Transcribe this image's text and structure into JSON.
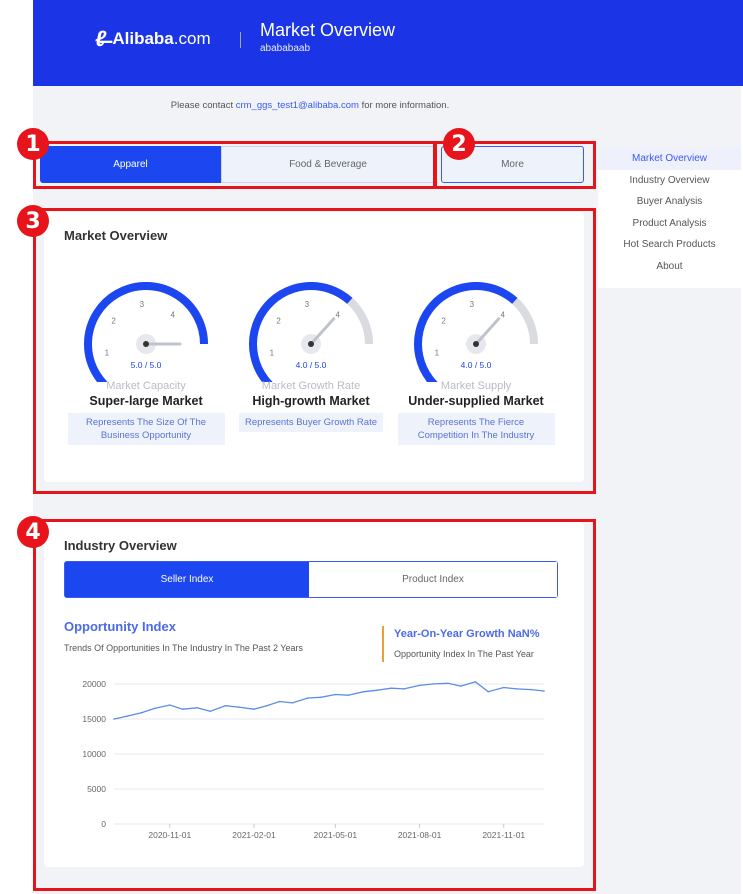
{
  "header": {
    "logo_text": "Alibaba",
    "logo_suffix": ".com",
    "title": "Market Overview",
    "subtitle": "abababaab"
  },
  "contact": {
    "prefix": "Please contact",
    "email": "crm_ggs_test1@alibaba.com",
    "suffix": "for more information."
  },
  "tabs": [
    {
      "label": "Apparel",
      "active": true
    },
    {
      "label": "Food & Beverage",
      "active": false
    },
    {
      "label": "More",
      "active": false
    }
  ],
  "sidenav": [
    {
      "label": "Market Overview",
      "active": true
    },
    {
      "label": "Industry Overview",
      "active": false
    },
    {
      "label": "Buyer Analysis",
      "active": false
    },
    {
      "label": "Product Analysis",
      "active": false
    },
    {
      "label": "Hot Search Products",
      "active": false
    },
    {
      "label": "About",
      "active": false
    }
  ],
  "market_overview": {
    "title": "Market Overview",
    "gauges": [
      {
        "label": "Market Capacity",
        "verdict": "Super-large Market",
        "desc": "Represents The Size Of The Business Opportunity",
        "value": 5.0,
        "max": 5.0,
        "readout": "5.0 / 5.0"
      },
      {
        "label": "Market Growth Rate",
        "verdict": "High-growth Market",
        "desc": "Represents Buyer Growth Rate",
        "value": 4.0,
        "max": 5.0,
        "readout": "4.0 / 5.0"
      },
      {
        "label": "Market Supply",
        "verdict": "Under-supplied Market",
        "desc": "Represents The Fierce Competition In The Industry",
        "value": 4.0,
        "max": 5.0,
        "readout": "4.0 / 5.0"
      }
    ],
    "tick_labels": [
      "1",
      "2",
      "3",
      "4"
    ]
  },
  "industry_overview": {
    "title": "Industry Overview",
    "segments": [
      {
        "label": "Seller Index",
        "active": true
      },
      {
        "label": "Product Index",
        "active": false
      }
    ],
    "opportunity_title": "Opportunity Index",
    "opportunity_sub": "Trends Of Opportunities In The Industry In The Past 2 Years",
    "yoy_title": "Year-On-Year Growth NaN%",
    "yoy_sub": "Opportunity Index In The Past Year"
  },
  "chart_data": {
    "type": "line",
    "ylim": [
      0,
      20000
    ],
    "yticks": [
      0,
      5000,
      10000,
      15000,
      20000
    ],
    "xticks": [
      "2020-11-01",
      "2021-02-01",
      "2021-05-01",
      "2021-08-01",
      "2021-11-01"
    ],
    "series": [
      {
        "x": [
          "2020-09-01",
          "2020-09-15",
          "2020-10-01",
          "2020-10-15",
          "2020-11-01",
          "2020-11-15",
          "2020-12-01",
          "2020-12-15",
          "2021-01-01",
          "2021-01-15",
          "2021-02-01",
          "2021-02-15",
          "2021-03-01",
          "2021-03-15",
          "2021-04-01",
          "2021-04-15",
          "2021-05-01",
          "2021-05-15",
          "2021-06-01",
          "2021-06-15",
          "2021-07-01",
          "2021-07-15",
          "2021-08-01",
          "2021-08-15",
          "2021-09-01",
          "2021-09-15",
          "2021-10-01",
          "2021-10-15",
          "2021-11-01",
          "2021-11-15",
          "2021-12-01",
          "2021-12-15"
        ],
        "y": [
          15000,
          15400,
          15900,
          16500,
          17000,
          16400,
          16600,
          16100,
          16900,
          16700,
          16400,
          16900,
          17500,
          17300,
          18000,
          18100,
          18500,
          18400,
          18900,
          19100,
          19400,
          19300,
          19800,
          20000,
          20100,
          19700,
          20300,
          18900,
          19500,
          19300,
          19200,
          19000
        ]
      }
    ]
  },
  "colors": {
    "brand": "#1b35e6",
    "accent": "#1b46f0",
    "gauge_track": "#d9dbe1",
    "line": "#5a8ee6",
    "highlight": "#e8141c"
  }
}
